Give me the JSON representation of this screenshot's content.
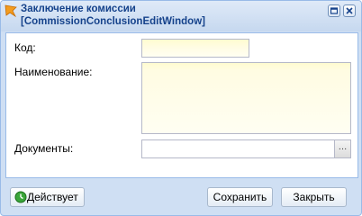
{
  "window": {
    "title_line1": "Заключение комиссии",
    "title_line2": "[CommissionConclusionEditWindow]"
  },
  "icons": {
    "title": "orange-wedge-icon",
    "maximize": "maximize-icon",
    "close": "close-icon",
    "status": "green-clock-icon",
    "trigger": "ellipsis-icon"
  },
  "form": {
    "code_label": "Код:",
    "code_value": "",
    "name_label": "Наименование:",
    "name_value": "",
    "documents_label": "Документы:",
    "documents_value": "",
    "documents_trigger": "…"
  },
  "footer": {
    "status_label": "Действует",
    "save_label": "Сохранить",
    "close_label": "Закрыть"
  },
  "colors": {
    "title_text": "#15428b",
    "window_bg": "#cfdff3",
    "border": "#99bbe8",
    "required_field_bg": "#fffce2"
  }
}
